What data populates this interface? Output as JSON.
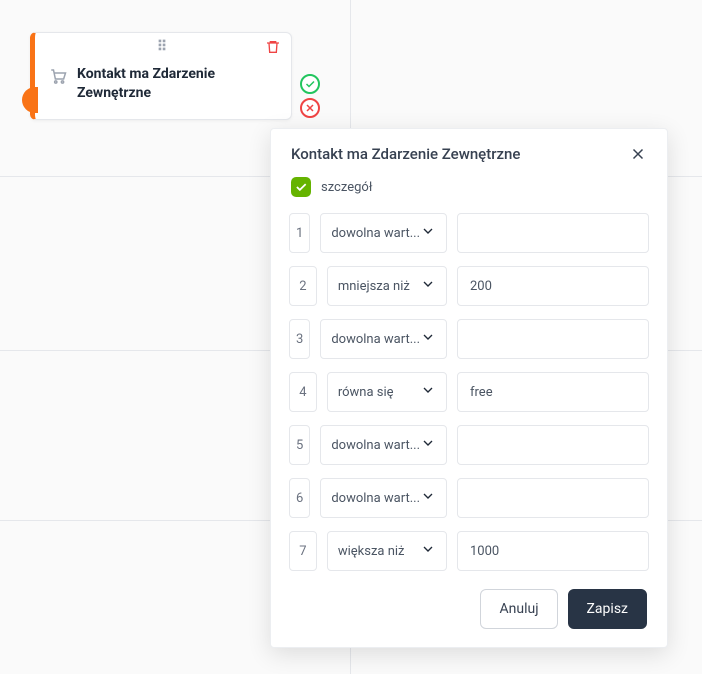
{
  "card": {
    "title": "Kontakt ma Zdarzenie Zewnętrzne"
  },
  "modal": {
    "title": "Kontakt ma Zdarzenie Zewnętrzne",
    "checkbox_label": "szczegół",
    "rows": [
      {
        "num": "1",
        "op": "dowolna wart...",
        "val": ""
      },
      {
        "num": "2",
        "op": "mniejsza niż",
        "val": "200"
      },
      {
        "num": "3",
        "op": "dowolna wart...",
        "val": ""
      },
      {
        "num": "4",
        "op": "równa się",
        "val": "free"
      },
      {
        "num": "5",
        "op": "dowolna wart...",
        "val": ""
      },
      {
        "num": "6",
        "op": "dowolna wart...",
        "val": ""
      },
      {
        "num": "7",
        "op": "większa niż",
        "val": "1000"
      }
    ],
    "cancel": "Anuluj",
    "save": "Zapisz"
  }
}
